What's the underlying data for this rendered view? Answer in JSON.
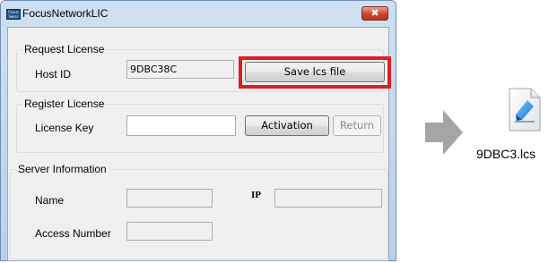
{
  "window": {
    "title": "FocusNetworkLIC",
    "app_icon_text": "Focus Swiss",
    "close_glyph": "✖"
  },
  "request_license": {
    "legend": "Request License",
    "host_id_label": "Host ID",
    "host_id_value": "9DBC38C",
    "save_button_label": "Save lcs file",
    "highlight_color": "#e01c24"
  },
  "register_license": {
    "legend": "Register License",
    "license_key_label": "License Key",
    "license_key_value": "",
    "activation_label": "Activation",
    "return_label": "Return"
  },
  "server_information": {
    "legend": "Server Information",
    "name_label": "Name",
    "name_value": "",
    "ip_label": "IP",
    "ip_value": "",
    "access_number_label": "Access Number",
    "access_number_value": ""
  },
  "output": {
    "arrow_icon": "right-arrow-icon",
    "file_icon": "document-icon",
    "file_name": "9DBC3.lcs"
  }
}
